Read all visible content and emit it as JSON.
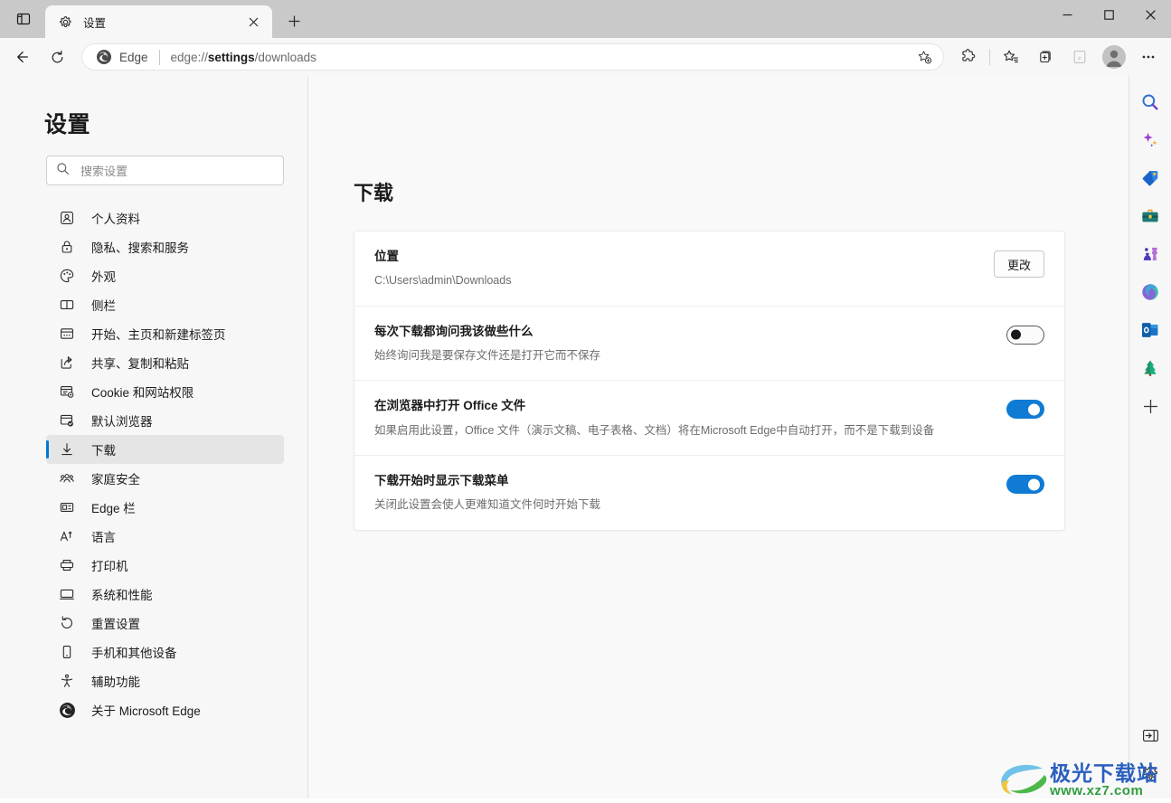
{
  "window": {
    "tabs": [
      {
        "title": "设置",
        "favicon": "gear-icon",
        "active": true
      }
    ],
    "new_tab_label": "+",
    "controls": {
      "minimize": "–",
      "maximize": "□",
      "close": "✕"
    }
  },
  "toolbar": {
    "back": "back-arrow-icon",
    "refresh": "refresh-icon",
    "omnibox": {
      "brand": "Edge",
      "url_prefix": "edge://",
      "url_bold": "settings",
      "url_suffix": "/downloads",
      "full_url": "edge://settings/downloads",
      "favorite_title": "添加到收藏夹"
    },
    "buttons": [
      {
        "name": "extensions-icon",
        "title": "扩展"
      },
      {
        "name": "favorites-icon",
        "title": "收藏夹"
      },
      {
        "name": "collections-icon",
        "title": "集锦"
      },
      {
        "name": "ie-mode-icon",
        "title": "Internet Explorer 模式"
      },
      {
        "name": "profile-avatar",
        "title": "个人资料"
      },
      {
        "name": "more-options-icon",
        "title": "设置及其他"
      }
    ]
  },
  "sidebar": {
    "title": "设置",
    "search": {
      "placeholder": "搜索设置",
      "value": ""
    },
    "items": [
      {
        "label": "个人资料",
        "icon": "profile-icon",
        "active": false
      },
      {
        "label": "隐私、搜索和服务",
        "icon": "lock-icon",
        "active": false
      },
      {
        "label": "外观",
        "icon": "palette-icon",
        "active": false
      },
      {
        "label": "侧栏",
        "icon": "sidebar-icon",
        "active": false
      },
      {
        "label": "开始、主页和新建标签页",
        "icon": "startpage-icon",
        "active": false
      },
      {
        "label": "共享、复制和粘贴",
        "icon": "share-icon",
        "active": false
      },
      {
        "label": "Cookie 和网站权限",
        "icon": "cookie-icon",
        "active": false
      },
      {
        "label": "默认浏览器",
        "icon": "default-browser-icon",
        "active": false
      },
      {
        "label": "下载",
        "icon": "download-icon",
        "active": true
      },
      {
        "label": "家庭安全",
        "icon": "family-icon",
        "active": false
      },
      {
        "label": "Edge 栏",
        "icon": "edge-bar-icon",
        "active": false
      },
      {
        "label": "语言",
        "icon": "language-icon",
        "active": false
      },
      {
        "label": "打印机",
        "icon": "printer-icon",
        "active": false
      },
      {
        "label": "系统和性能",
        "icon": "system-icon",
        "active": false
      },
      {
        "label": "重置设置",
        "icon": "reset-icon",
        "active": false
      },
      {
        "label": "手机和其他设备",
        "icon": "phone-icon",
        "active": false
      },
      {
        "label": "辅助功能",
        "icon": "accessibility-icon",
        "active": false
      },
      {
        "label": "关于 Microsoft Edge",
        "icon": "edge-logo-icon",
        "active": false
      }
    ]
  },
  "main": {
    "page_title": "下载",
    "rows": [
      {
        "title": "位置",
        "subtitle": "C:\\Users\\admin\\Downloads",
        "control": "button",
        "button_label": "更改"
      },
      {
        "title": "每次下载都询问我该做些什么",
        "subtitle": "始终询问我是要保存文件还是打开它而不保存",
        "control": "toggle",
        "toggle_state": "off"
      },
      {
        "title": "在浏览器中打开 Office 文件",
        "subtitle": "如果启用此设置，Office 文件（演示文稿、电子表格、文档）将在Microsoft Edge中自动打开，而不是下载到设备",
        "control": "toggle",
        "toggle_state": "on"
      },
      {
        "title": "下载开始时显示下载菜单",
        "subtitle": "关闭此设置会使人更难知道文件何时开始下载",
        "control": "toggle",
        "toggle_state": "on"
      }
    ]
  },
  "edgebar": {
    "items": [
      {
        "name": "search-icon",
        "title": "搜索"
      },
      {
        "name": "copilot-icon",
        "title": "Copilot"
      },
      {
        "name": "shopping-tag-icon",
        "title": "购物"
      },
      {
        "name": "tools-icon",
        "title": "工具"
      },
      {
        "name": "games-icon",
        "title": "游戏"
      },
      {
        "name": "microsoft365-icon",
        "title": "Microsoft 365"
      },
      {
        "name": "outlook-icon",
        "title": "Outlook"
      },
      {
        "name": "drop-tree-icon",
        "title": "Drop"
      },
      {
        "name": "add-icon",
        "title": "自定义"
      }
    ],
    "bottom": [
      {
        "name": "expand-panel-icon",
        "title": "展开侧栏"
      },
      {
        "name": "sidebar-settings-icon",
        "title": "侧栏设置"
      }
    ]
  },
  "watermark": {
    "main_text": "极光下载站",
    "sub_text": "www.xz7.com"
  },
  "colors": {
    "accent": "#0078d4",
    "toggle_on": "#0f7bd4",
    "titlebar": "#c9c9c9",
    "chrome": "#f7f7f7",
    "main_bg": "#f9f9f9",
    "card_bg": "#ffffff",
    "text_primary": "#1b1b1b",
    "text_secondary": "#6c6c6c"
  }
}
